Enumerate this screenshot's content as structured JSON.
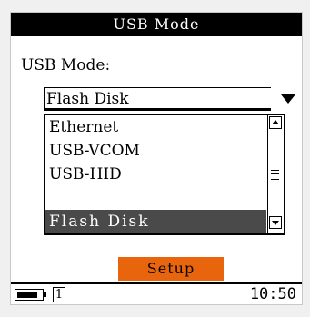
{
  "window": {
    "title": "USB Mode"
  },
  "form": {
    "label": "USB Mode:",
    "selected_value": "Flash Disk"
  },
  "dropdown": {
    "options": [
      "Ethernet",
      "USB-VCOM",
      "USB-HID",
      "Flash Disk"
    ],
    "selected_index": 3
  },
  "actions": {
    "setup_label": "Setup"
  },
  "statusbar": {
    "battery_level": 0.85,
    "page_number": "1",
    "time": "10:50"
  },
  "colors": {
    "titlebar_bg": "#000000",
    "setup_button": "#e8650e",
    "selected_item_bg": "#4a4a4a"
  }
}
